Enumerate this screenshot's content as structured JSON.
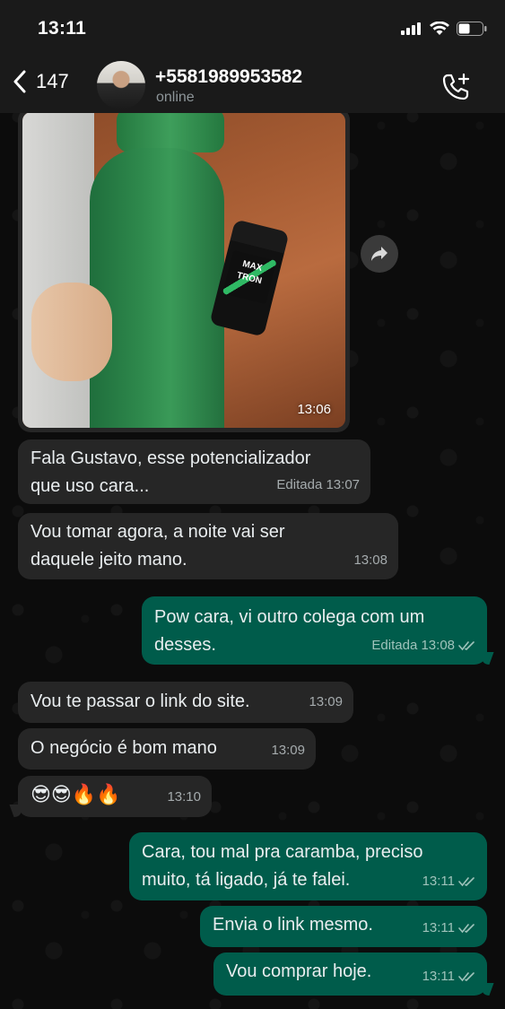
{
  "status_bar": {
    "time": "13:11"
  },
  "header": {
    "back_count": "147",
    "contact_name": "+5581989953582",
    "contact_status": "online"
  },
  "image_message": {
    "time": "13:06",
    "jar_label": "MAX TRON"
  },
  "messages": [
    {
      "text": "Fala Gustavo, esse potencializador\nque uso cara...",
      "meta": "Editada 13:07"
    },
    {
      "text": "Vou tomar agora, a noite vai ser\ndaquele jeito mano.",
      "meta": "13:08"
    },
    {
      "text": "Pow cara, vi outro colega com um\ndesses.",
      "meta": "Editada 13:08"
    },
    {
      "text": "Vou te passar o link do site.",
      "meta": "13:09"
    },
    {
      "text": "O negócio é bom mano",
      "meta": "13:09"
    },
    {
      "text": "😎😎🔥🔥",
      "meta": "13:10"
    },
    {
      "text": "Cara, tou mal pra caramba, preciso\nmuito, tá ligado, já te falei.",
      "meta": "13:11"
    },
    {
      "text": "Envia o link mesmo.",
      "meta": "13:11"
    },
    {
      "text": "Vou comprar hoje.",
      "meta": "13:11"
    }
  ],
  "colors": {
    "incoming_bubble": "#262626",
    "outgoing_bubble": "#005c4b",
    "header_bg": "#1a1a1a",
    "read_ticks": "#9fc3bb"
  },
  "icons": [
    "back-chevron-icon",
    "signal-icon",
    "wifi-icon",
    "battery-icon",
    "add-call-icon",
    "forward-icon",
    "read-receipt-icon"
  ]
}
